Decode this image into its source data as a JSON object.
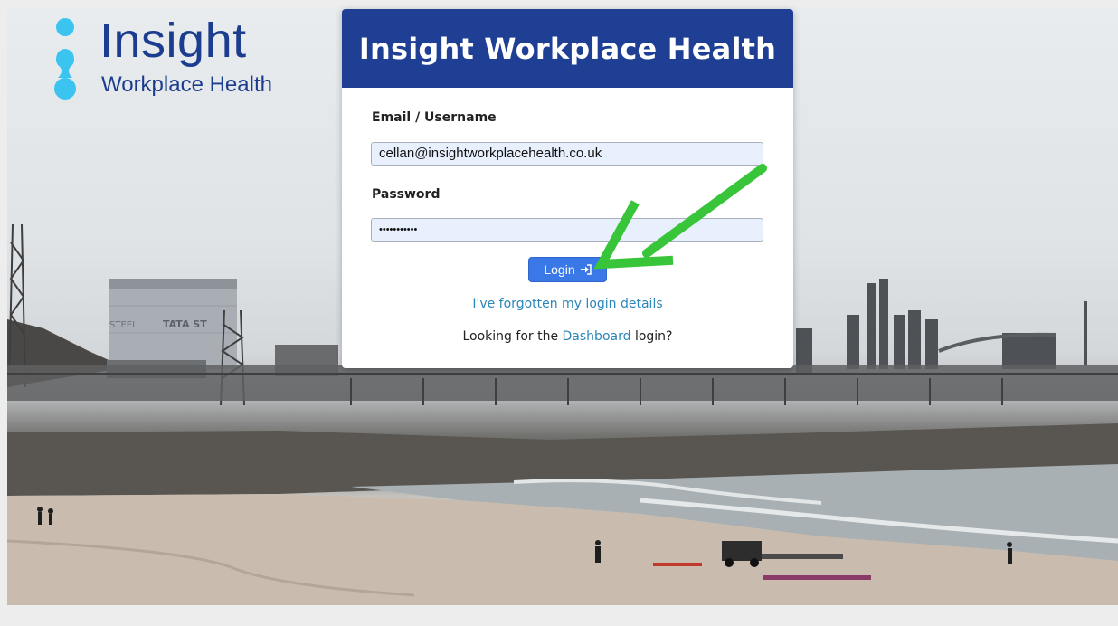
{
  "brand": {
    "word": "Insight",
    "sub": "Workplace Health",
    "primary_color": "#1e3f94",
    "accent_color": "#3bc4f0"
  },
  "background": {
    "description_icon": "industrial-beach-photo",
    "tower_text_left": "STEEL",
    "tower_text_right": "TATA ST"
  },
  "form": {
    "title": "Insight Workplace Health",
    "email_label": "Email / Username",
    "email_value": "cellan@insightworkplacehealth.co.uk",
    "password_label": "Password",
    "password_value": "•••••••••••",
    "login_label": "Login",
    "login_icon": "sign-in-icon",
    "forgot_link": "I've forgotten my login details",
    "dashboard_prefix": "Looking for the ",
    "dashboard_link": "Dashboard",
    "dashboard_suffix": " login?"
  },
  "annotation": {
    "arrow_color": "#39c53a"
  }
}
